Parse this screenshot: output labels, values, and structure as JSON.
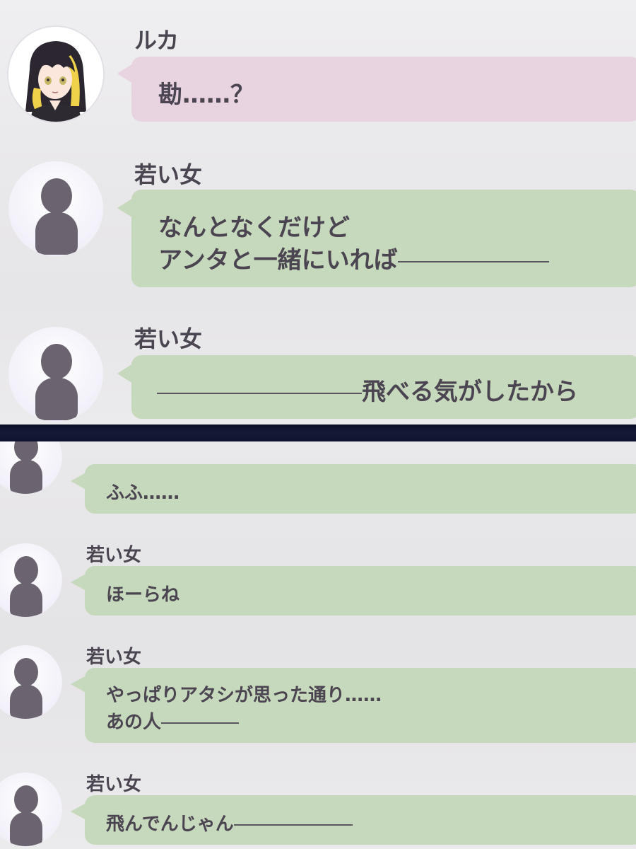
{
  "top_panel": {
    "messages": [
      {
        "speaker": "ルカ",
        "lines": [
          "勘……？"
        ],
        "style": "pink",
        "avatar": "ruka-portrait"
      },
      {
        "speaker": "若い女",
        "lines": [
          "なんとなくだけど",
          "アンタと一緒にいれば"
        ],
        "style": "green",
        "avatar": "silhouette"
      },
      {
        "speaker": "若い女",
        "lines": [
          "飛べる気がしたから"
        ],
        "style": "green",
        "avatar": "silhouette"
      }
    ]
  },
  "bottom_panel": {
    "messages": [
      {
        "speaker": "",
        "lines": [
          "ふふ……"
        ],
        "style": "green",
        "avatar": "silhouette"
      },
      {
        "speaker": "若い女",
        "lines": [
          "ほーらね"
        ],
        "style": "green",
        "avatar": "silhouette"
      },
      {
        "speaker": "若い女",
        "lines": [
          "やっぱりアタシが思った通り……",
          "あの人"
        ],
        "style": "green",
        "avatar": "silhouette"
      },
      {
        "speaker": "若い女",
        "lines": [
          "飛んでんじゃん"
        ],
        "style": "green",
        "avatar": "silhouette"
      }
    ]
  },
  "colors": {
    "pink_bubble": "#e8d4e0",
    "green_bubble": "#c7d9bc",
    "text": "#4a4550",
    "silhouette": "#6b6470",
    "divider": "#0e1330"
  }
}
